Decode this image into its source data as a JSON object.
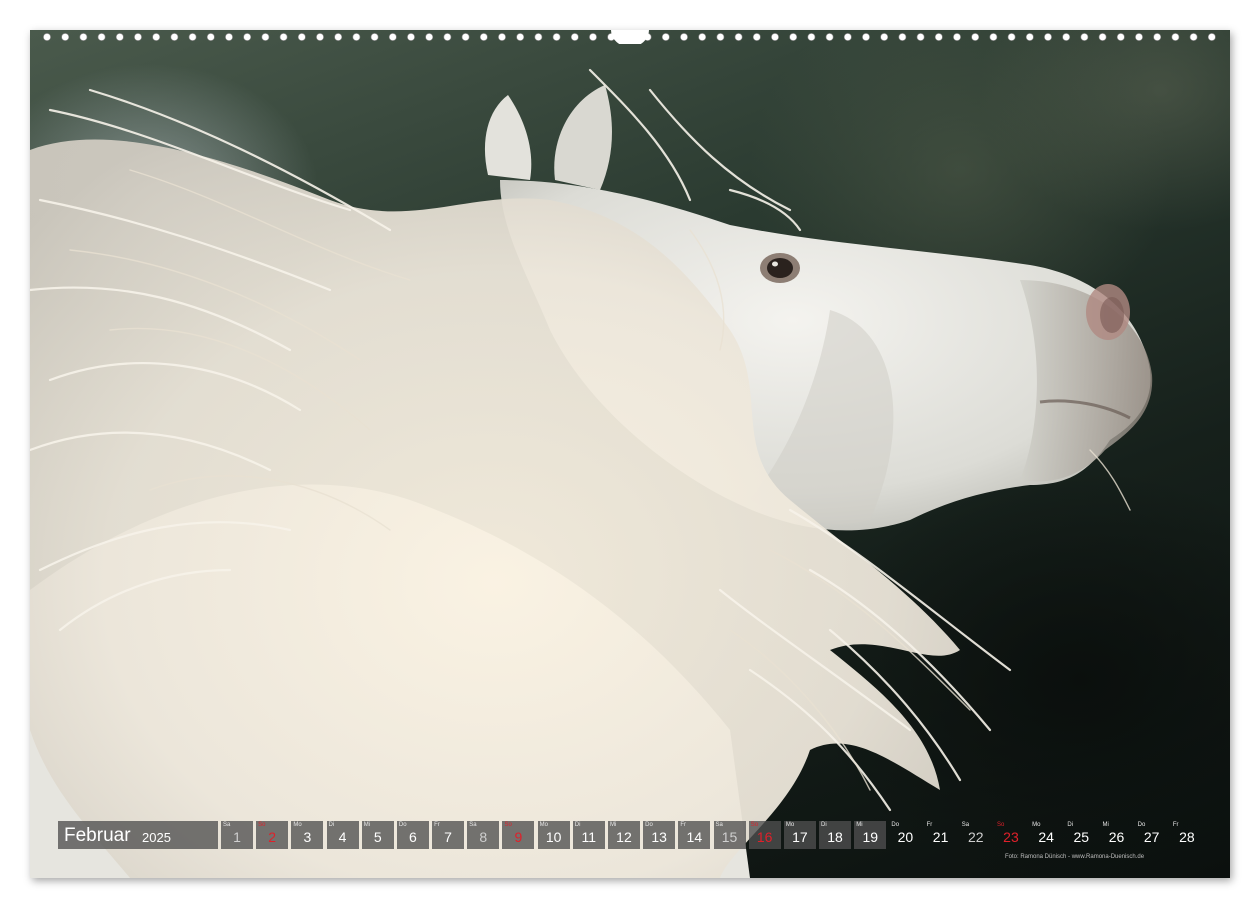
{
  "calendar": {
    "month": "Februar",
    "year": "2025",
    "days": [
      {
        "dn": "Sa",
        "num": "1",
        "type": "weekend"
      },
      {
        "dn": "So",
        "num": "2",
        "type": "holiday"
      },
      {
        "dn": "Mo",
        "num": "3",
        "type": "normal"
      },
      {
        "dn": "Di",
        "num": "4",
        "type": "normal"
      },
      {
        "dn": "Mi",
        "num": "5",
        "type": "normal"
      },
      {
        "dn": "Do",
        "num": "6",
        "type": "normal"
      },
      {
        "dn": "Fr",
        "num": "7",
        "type": "normal"
      },
      {
        "dn": "Sa",
        "num": "8",
        "type": "weekend"
      },
      {
        "dn": "So",
        "num": "9",
        "type": "holiday"
      },
      {
        "dn": "Mo",
        "num": "10",
        "type": "normal"
      },
      {
        "dn": "Di",
        "num": "11",
        "type": "normal"
      },
      {
        "dn": "Mi",
        "num": "12",
        "type": "normal"
      },
      {
        "dn": "Do",
        "num": "13",
        "type": "normal"
      },
      {
        "dn": "Fr",
        "num": "14",
        "type": "normal"
      },
      {
        "dn": "Sa",
        "num": "15",
        "type": "weekend"
      },
      {
        "dn": "So",
        "num": "16",
        "type": "holiday"
      },
      {
        "dn": "Mo",
        "num": "17",
        "type": "normal"
      },
      {
        "dn": "Di",
        "num": "18",
        "type": "normal"
      },
      {
        "dn": "Mi",
        "num": "19",
        "type": "normal"
      },
      {
        "dn": "Do",
        "num": "20",
        "type": "normal"
      },
      {
        "dn": "Fr",
        "num": "21",
        "type": "normal"
      },
      {
        "dn": "Sa",
        "num": "22",
        "type": "weekend"
      },
      {
        "dn": "So",
        "num": "23",
        "type": "holiday"
      },
      {
        "dn": "Mo",
        "num": "24",
        "type": "normal"
      },
      {
        "dn": "Di",
        "num": "25",
        "type": "normal"
      },
      {
        "dn": "Mi",
        "num": "26",
        "type": "normal"
      },
      {
        "dn": "Do",
        "num": "27",
        "type": "normal"
      },
      {
        "dn": "Fr",
        "num": "28",
        "type": "normal"
      }
    ]
  },
  "credit": "Foto: Ramona Dünisch - www.Ramona-Duenisch.de",
  "colors": {
    "sunday_red": "#e0202a",
    "label_box": "#505050"
  }
}
